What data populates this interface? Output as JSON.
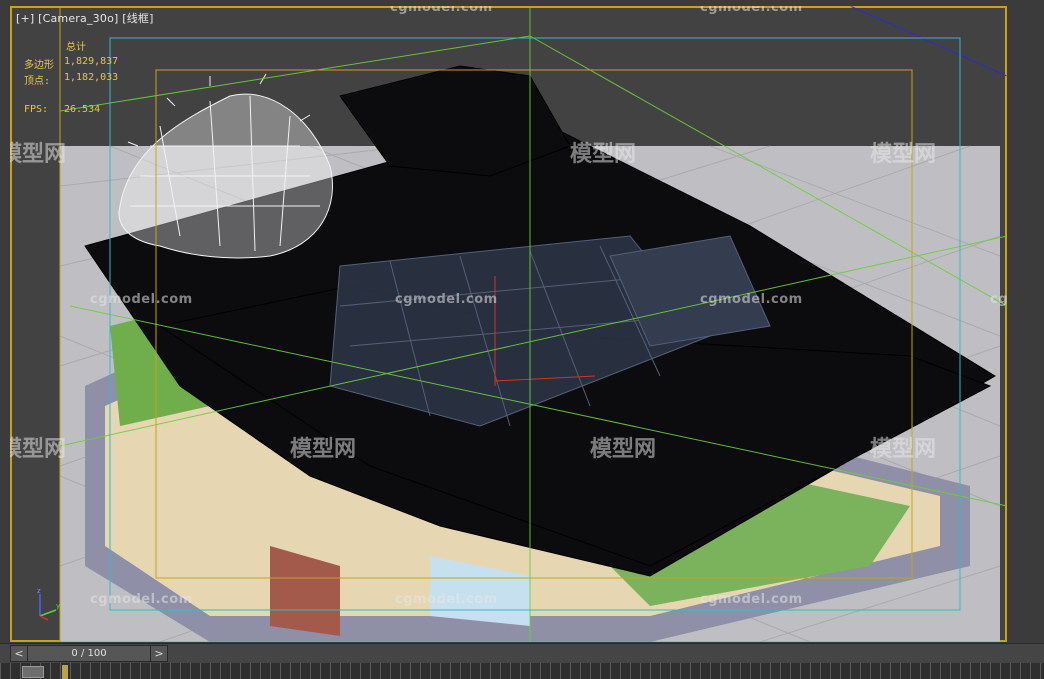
{
  "viewport": {
    "label_parts": [
      "[+]",
      "[Camera_30o]",
      "[线框]"
    ]
  },
  "stats": {
    "total_label": "总计",
    "polys_label": "多边形",
    "polys_value": "1,829,837",
    "verts_label": "顶点:",
    "verts_value": "1,182,033",
    "fps_label": "FPS:",
    "fps_value": "26.534"
  },
  "watermarks": {
    "site": "cgmodel.com",
    "cn": "模型网"
  },
  "timeline": {
    "prev_icon": "<",
    "next_icon": ">",
    "frame_display": "0 / 100"
  },
  "colors": {
    "viewport_border": "#c9a21b",
    "safe_frame_outer": "#34b8c9",
    "safe_frame_inner": "#c9a21b",
    "grid_green": "#6bcf3a",
    "stats_text": "#e7c64a"
  },
  "icons": {
    "axis_gizmo": "xyz-axis-gizmo-icon",
    "track_icon": "key-filter-icon"
  }
}
